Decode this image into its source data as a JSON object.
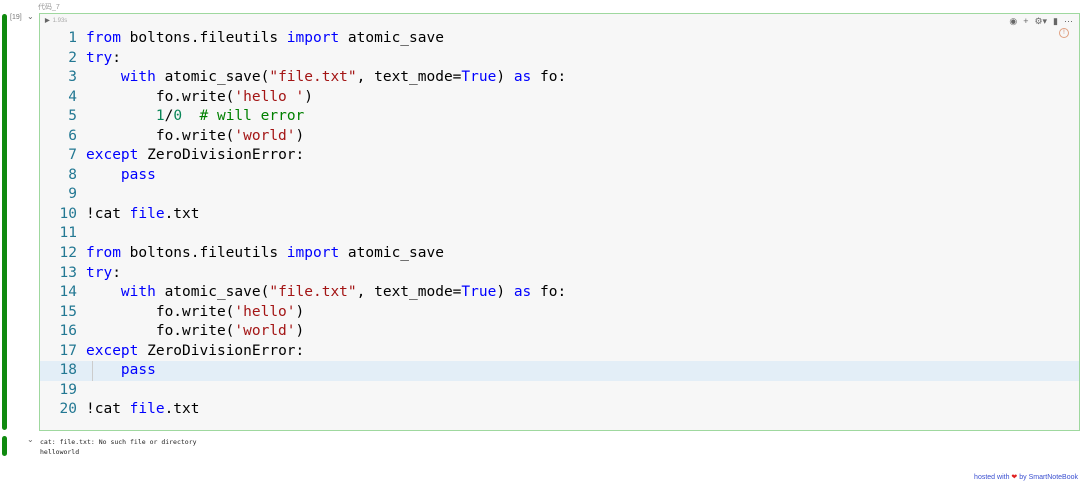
{
  "cell": {
    "label": "代码_7",
    "exec_count": "[19]",
    "run_time": "1.93s",
    "run_icon": "play-icon"
  },
  "toolbar": {
    "icons": [
      "eye-icon",
      "plus-icon",
      "settings-icon",
      "trash-icon",
      "more-icon"
    ]
  },
  "code": [
    [
      [
        "kw",
        "from"
      ],
      [
        "tx",
        " boltons.fileutils "
      ],
      [
        "kw",
        "import"
      ],
      [
        "tx",
        " atomic_save"
      ]
    ],
    [
      [
        "kw",
        "try"
      ],
      [
        "tx",
        ":"
      ]
    ],
    [
      [
        "tx",
        "    "
      ],
      [
        "kw",
        "with"
      ],
      [
        "tx",
        " atomic_save("
      ],
      [
        "str",
        "\"file.txt\""
      ],
      [
        "tx",
        ", text_mode="
      ],
      [
        "kw",
        "True"
      ],
      [
        "tx",
        ") "
      ],
      [
        "kw",
        "as"
      ],
      [
        "tx",
        " fo:"
      ]
    ],
    [
      [
        "tx",
        "        fo.write("
      ],
      [
        "str",
        "'hello '"
      ],
      [
        "tx",
        ")"
      ]
    ],
    [
      [
        "tx",
        "        "
      ],
      [
        "num",
        "1"
      ],
      [
        "tx",
        "/"
      ],
      [
        "num",
        "0"
      ],
      [
        "tx",
        "  "
      ],
      [
        "cm",
        "# will error"
      ]
    ],
    [
      [
        "tx",
        "        fo.write("
      ],
      [
        "str",
        "'world'"
      ],
      [
        "tx",
        ")"
      ]
    ],
    [
      [
        "kw",
        "except"
      ],
      [
        "tx",
        " ZeroDivisionError:"
      ]
    ],
    [
      [
        "tx",
        "    "
      ],
      [
        "kw",
        "pass"
      ]
    ],
    [],
    [
      [
        "tx",
        "!cat "
      ],
      [
        "kw",
        "file"
      ],
      [
        "tx",
        ".txt"
      ]
    ],
    [],
    [
      [
        "kw",
        "from"
      ],
      [
        "tx",
        " boltons.fileutils "
      ],
      [
        "kw",
        "import"
      ],
      [
        "tx",
        " atomic_save"
      ]
    ],
    [
      [
        "kw",
        "try"
      ],
      [
        "tx",
        ":"
      ]
    ],
    [
      [
        "tx",
        "    "
      ],
      [
        "kw",
        "with"
      ],
      [
        "tx",
        " atomic_save("
      ],
      [
        "str",
        "\"file.txt\""
      ],
      [
        "tx",
        ", text_mode="
      ],
      [
        "kw",
        "True"
      ],
      [
        "tx",
        ") "
      ],
      [
        "kw",
        "as"
      ],
      [
        "tx",
        " fo:"
      ]
    ],
    [
      [
        "tx",
        "        fo.write("
      ],
      [
        "str",
        "'hello'"
      ],
      [
        "tx",
        ")"
      ]
    ],
    [
      [
        "tx",
        "        fo.write("
      ],
      [
        "str",
        "'world'"
      ],
      [
        "tx",
        ")"
      ]
    ],
    [
      [
        "kw",
        "except"
      ],
      [
        "tx",
        " ZeroDivisionError:"
      ]
    ],
    [
      [
        "tx",
        "    "
      ],
      [
        "kw",
        "pass"
      ]
    ],
    [],
    [
      [
        "tx",
        "!cat "
      ],
      [
        "kw",
        "file"
      ],
      [
        "tx",
        ".txt"
      ]
    ]
  ],
  "highlight_line": 18,
  "output": [
    "cat: file.txt: No such file or directory",
    "helloworld"
  ],
  "footer": {
    "prefix": "hosted with",
    "heart": "❤",
    "suffix": "by SmartNoteBook"
  }
}
